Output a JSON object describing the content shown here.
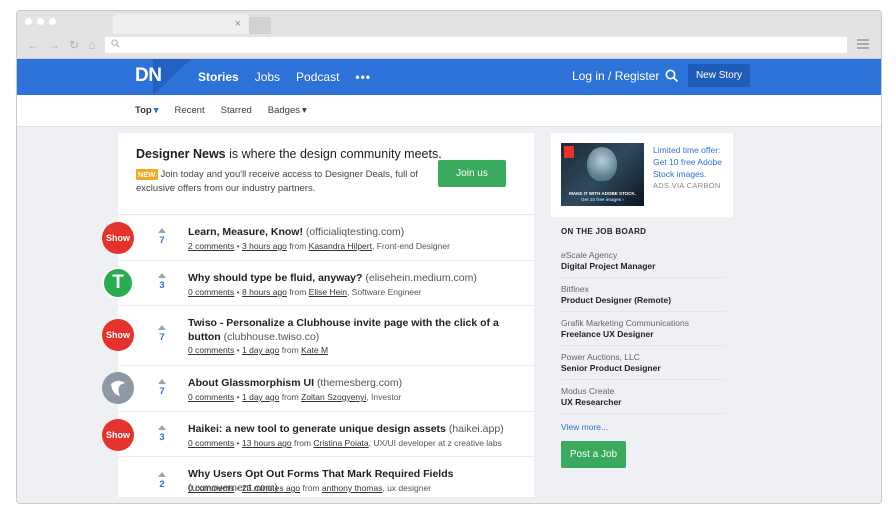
{
  "browser": {
    "tab_close": "×",
    "nav_buttons": [
      "←",
      "→",
      "↻",
      "⌂"
    ],
    "url_icon": "search-icon",
    "menu_icon": "hamburger-icon"
  },
  "header": {
    "logo": "DN",
    "nav": [
      "Stories",
      "Jobs",
      "Podcast"
    ],
    "more": "•••",
    "login": "Log in / Register",
    "new_story": "New Story"
  },
  "subnav": {
    "items": [
      "Top",
      "Recent",
      "Starred",
      "Badges"
    ],
    "caret": "▾"
  },
  "welcome": {
    "brand": "Designer News",
    "headline_rest": " is where the design community meets.",
    "badge": "NEW",
    "body": "Join today and you'll receive access to Designer Deals, full of exclusive offers from our industry partners.",
    "join": "Join us"
  },
  "stories": [
    {
      "avatar": "Show",
      "votes": "7",
      "title": "Learn, Measure, Know!",
      "domain": "(officialiqtesting.com)",
      "comments": "2 comments",
      "time": "3 hours ago",
      "from": "from",
      "author": "Kasandra Hilpert",
      "role": ", Front-end Designer"
    },
    {
      "avatar": "T",
      "votes": "3",
      "title": "Why should type be fluid, anyway?",
      "domain": "(elisehein.medium.com)",
      "comments": "0 comments",
      "time": "8 hours ago",
      "from": "from",
      "author": "Elise Hein",
      "role": ", Software Engineer"
    },
    {
      "avatar": "Show",
      "votes": "7",
      "title": "Twiso - Personalize a Clubhouse invite page with the click of a button",
      "domain": "(clubhouse.twiso.co)",
      "comments": "0 comments",
      "time": "1 day ago",
      "from": "from",
      "author": "Kate M",
      "role": ""
    },
    {
      "avatar": "",
      "votes": "7",
      "title": "About Glassmorphism UI",
      "domain": "(themesberg.com)",
      "comments": "0 comments",
      "time": "1 day ago",
      "from": "from",
      "author": "Zoltan Szogyenyi",
      "role": ", Investor"
    },
    {
      "avatar": "Show",
      "votes": "3",
      "title": "Haikei: a new tool to generate unique design assets",
      "domain": "(haikei.app)",
      "comments": "0 comments",
      "time": "13 hours ago",
      "from": "from",
      "author": "Cristina Poiata",
      "role": ", UX/UI developer at z creative labs"
    },
    {
      "avatar": "",
      "votes": "2",
      "title": "Why Users Opt Out Forms That Mark Required Fields",
      "domain": "(uxmovement.com)",
      "comments": "0 comments",
      "time": "23 minutes ago",
      "from": "from",
      "author": "anthony thomas",
      "role": ", ux designer"
    }
  ],
  "meta_sep": " • ",
  "ad": {
    "image_caption": "MAKE IT WITH ADOBE STOCK.",
    "image_caption2": "Get 10 free images ›",
    "text": "Limited time offer: Get 10 free Adobe Stock images.",
    "tag": "ADS VIA CARBON"
  },
  "jobboard": {
    "title": "ON THE JOB BOARD",
    "jobs": [
      {
        "company": "eScale Agency",
        "title": "Digital Project Manager"
      },
      {
        "company": "Bitfinex",
        "title": "Product Designer (Remote)"
      },
      {
        "company": "Grafik Marketing Communications",
        "title": "Freelance UX Designer"
      },
      {
        "company": "Power Auctions, LLC",
        "title": "Senior Product Designer"
      },
      {
        "company": "Modus Create",
        "title": "UX Researcher"
      }
    ],
    "view_more": "View more...",
    "post_job": "Post a Job"
  },
  "colors": {
    "brand_blue": "#2d72d9",
    "green": "#3aaa5f",
    "show_red": "#e5322d"
  }
}
